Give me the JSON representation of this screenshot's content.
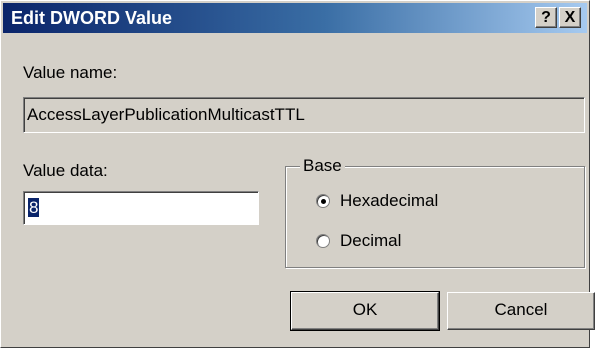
{
  "window": {
    "title": "Edit DWORD Value",
    "help_label": "?",
    "close_label": "X"
  },
  "value_name": {
    "label": "Value name:",
    "value": "AccessLayerPublicationMulticastTTL"
  },
  "value_data": {
    "label": "Value data:",
    "value": "8"
  },
  "base": {
    "legend": "Base",
    "options": [
      {
        "label": "Hexadecimal",
        "selected": true
      },
      {
        "label": "Decimal",
        "selected": false
      }
    ]
  },
  "buttons": {
    "ok_label": "OK",
    "cancel_label": "Cancel"
  }
}
